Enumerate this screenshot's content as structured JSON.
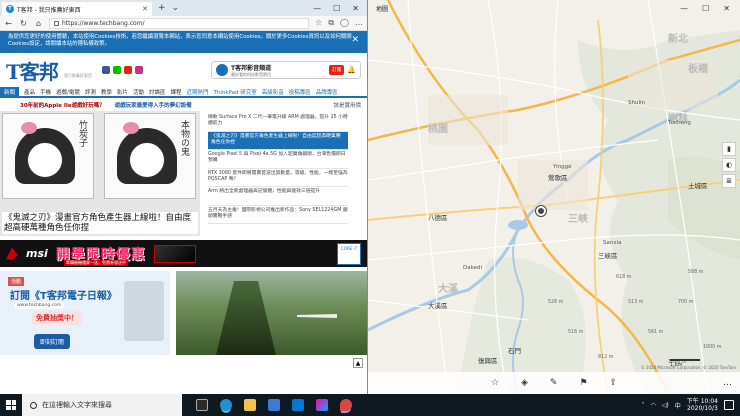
{
  "browser": {
    "tab_title": "T客邦 - 我只推薦好東西",
    "url": "https://www.techbang.com/",
    "cookie_notice": "為提供您更好的使用體驗，本站使用Cookies技術，若您繼續瀏覽本網站，表示您同意本網站使用Cookies。關於更多Cookies資訊以及如何關閉Cookies設定，請閱讀本站的隱私權政策。",
    "logo": "T客邦",
    "logo_sub": "我只推薦好東西",
    "channel_name": "T客邦影音頻道",
    "channel_sub": "最好看的科技影音節目",
    "subscribe": "訂閱",
    "nav": [
      "新聞",
      "產品",
      "手機",
      "遊戲/電競",
      "評測",
      "教學",
      "影片",
      "活動",
      "討論區",
      "課程",
      "近期熱門",
      "ThinkPad 研究室",
      "高級影音",
      "投稿專區",
      "品牌專區"
    ],
    "headlines": {
      "left": "30年前的Apple IIe遊戲好玩嗎？",
      "mid": "遊戲玩家最愛得入手的夢幻設備",
      "right": "該是實用價"
    },
    "hero_caption": "《鬼滅之刃》漫畫官方角色產生器上線啦！自由度超高硬萬種角色任你捏",
    "news": [
      "微軟 Surface Pro X 二代一筆電升級 ARM 處理器，提升 15 小時續航力",
      "《鬼滅之刃》漫畫官方角色產生器上線啦！自由度超高硬萬種角色任你捏",
      "Google Pixel 5 與 Pixel 4a 5G 加入超廣角鏡頭，台灣售價即日預購",
      "RTX 3080 套件即將開賣首波出貨數量，等級、性能，一樣至強為 POSCAP 嗎？",
      "Arm 將出全新處理器與記憶體，性能與能效三倍提升",
      "五月天為主角！國際影視公司推出新作品：Sony SEL1224GM 鏡頭實戰手感"
    ],
    "msi_ad": {
      "brand": "msi",
      "promo": "開學限時優惠",
      "sub": "單購機機種買一送，免費券發送中",
      "chip": "CORE i7"
    },
    "tk_ad": {
      "join": "活動",
      "title": "訂閱《T客邦電子日報》",
      "site": "www.techbang.com",
      "gift": "免費抽獎中！",
      "button": "即刻訂閱"
    }
  },
  "maps": {
    "title": "地圖",
    "labels": {
      "big": [
        "桃園",
        "新北",
        "樹林",
        "三峽",
        "板橋",
        "大溪"
      ],
      "towns": [
        "八德區",
        "鶯歌區",
        "三峽區",
        "大溪區",
        "復興區",
        "石門",
        "土城區"
      ],
      "roads": [
        "Tucheng",
        "Sanxia",
        "Shulin",
        "Yingge",
        "Dakedi"
      ],
      "peaks": [
        "618 m",
        "700 m",
        "561 m",
        "1000 m",
        "1026 m",
        "516 m",
        "526 m",
        "812 m",
        "513 m",
        "588 m"
      ]
    },
    "scale": "1 km",
    "copyright": "© 2020 Microsoft Corporation, © 2020 TomTom"
  },
  "taskbar": {
    "search_placeholder": "在這裡輸入文字來搜尋",
    "time": "下午 10:04",
    "date": "2020/10/3",
    "lang": "中"
  }
}
